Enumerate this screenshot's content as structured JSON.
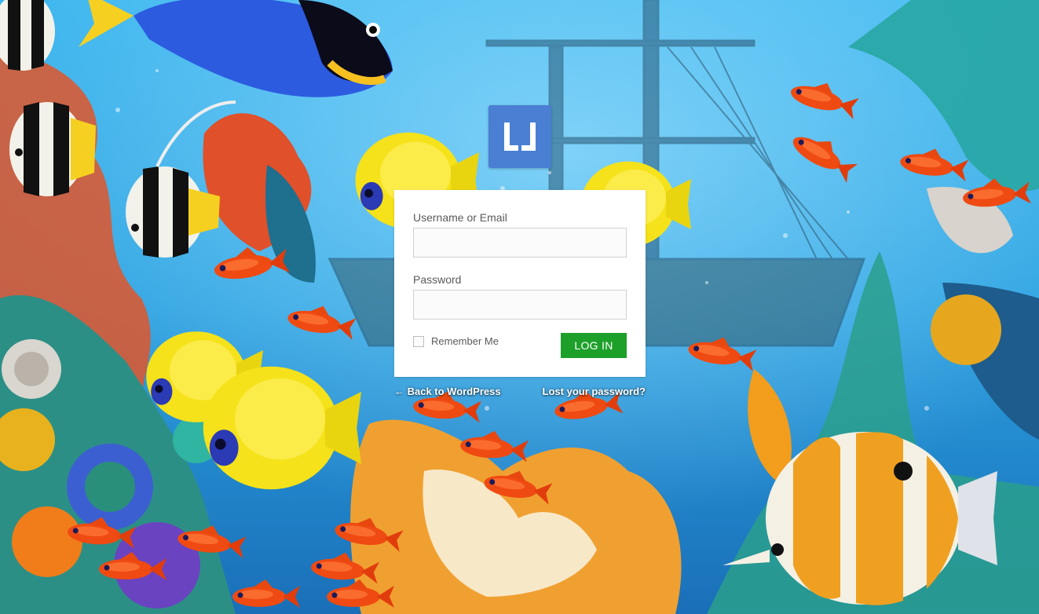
{
  "login_form": {
    "username_label": "Username or Email",
    "username_value": "",
    "password_label": "Password",
    "password_value": "",
    "remember_label": "Remember Me",
    "remember_checked": false,
    "submit_label": "LOG IN"
  },
  "links": {
    "back_label": "← Back to WordPress",
    "lost_password_label": "Lost your password?"
  },
  "colors": {
    "logo_bg": "#4a7fd4",
    "button_bg": "#1da02a",
    "sea_top": "#3fb4ec",
    "sea_bottom": "#1f7fc9"
  },
  "icons": {
    "logo": "li-logo-icon",
    "checkbox": "checkbox-icon"
  }
}
